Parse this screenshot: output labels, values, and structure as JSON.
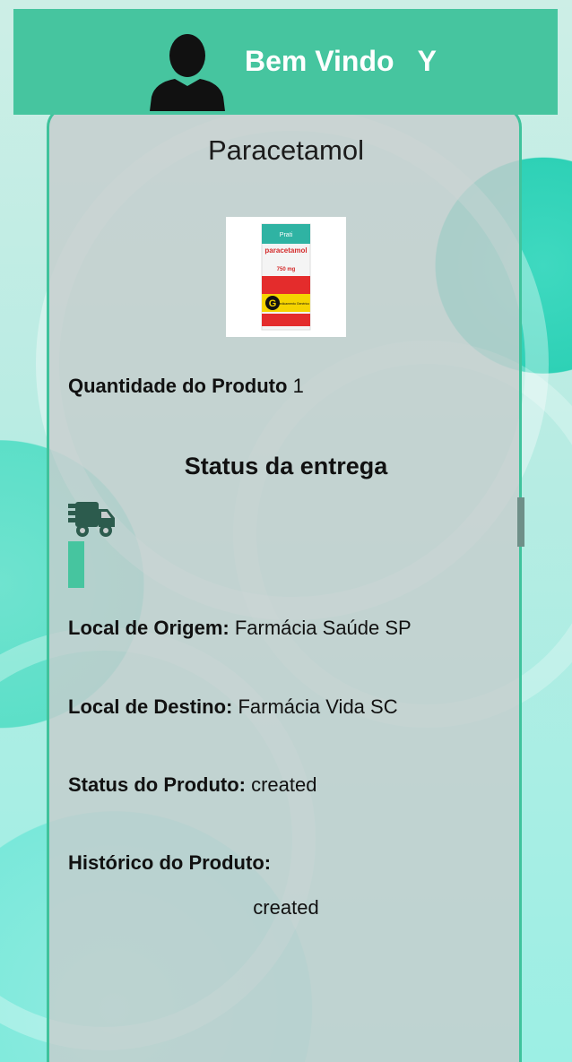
{
  "header": {
    "title": "Bem Vindo   Y",
    "avatar_icon": "user-silhouette-icon",
    "background_color": "#46c59f"
  },
  "product": {
    "name": "Paracetamol",
    "image_labels": {
      "brand": "Prati",
      "name": "paracetamol",
      "dose": "750 mg",
      "generic_letter": "G",
      "generic_text": "Medicamento Genérico"
    },
    "quantity_label": "Quantidade do Produto",
    "quantity_value": "1"
  },
  "delivery": {
    "title": "Status da entrega",
    "truck_icon": "delivery-truck-icon",
    "progress_fraction": 1.0,
    "origin_label": "Local de Origem:",
    "origin_value": "Farmácia Saúde SP",
    "destination_label": "Local de Destino:",
    "destination_value": "Farmácia Vida SC",
    "status_label": "Status do Produto:",
    "status_value": "created",
    "history_label": "Histórico do Produto:",
    "history": [
      "created"
    ]
  },
  "colors": {
    "accent": "#46c59f",
    "truck": "#2c5b4d"
  }
}
